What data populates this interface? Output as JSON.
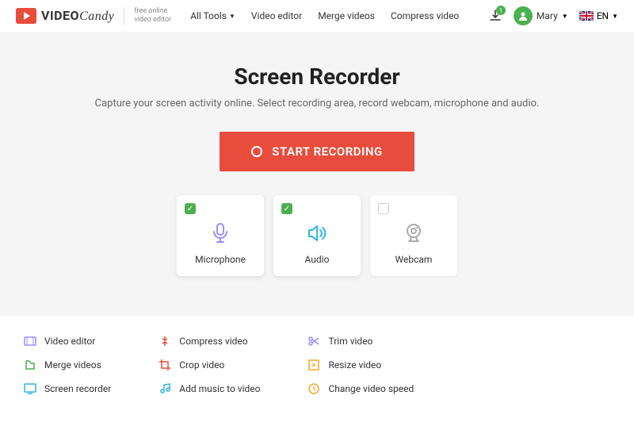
{
  "header": {
    "logo": {
      "text1": "VIDEO",
      "text2": "Candy",
      "tagline1": "free online",
      "tagline2": "video editor"
    },
    "nav": [
      "All Tools",
      "Video editor",
      "Merge videos",
      "Compress video"
    ],
    "download_badge": "1",
    "user": "Mary",
    "lang": "EN"
  },
  "hero": {
    "title": "Screen Recorder",
    "subtitle": "Capture your screen activity online. Select recording area, record webcam, microphone and audio.",
    "button": "START RECORDING"
  },
  "options": [
    {
      "label": "Microphone",
      "checked": true
    },
    {
      "label": "Audio",
      "checked": true
    },
    {
      "label": "Webcam",
      "checked": false
    }
  ],
  "tools": [
    [
      "Video editor",
      "Merge videos",
      "Screen recorder"
    ],
    [
      "Compress video",
      "Crop video",
      "Add music to video"
    ],
    [
      "Trim video",
      "Resize video",
      "Change video speed"
    ]
  ]
}
